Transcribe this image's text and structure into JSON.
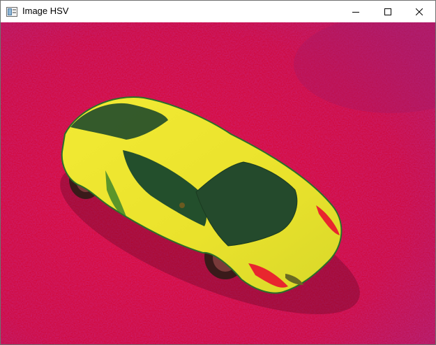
{
  "window": {
    "title": "Image HSV"
  },
  "icons": {
    "app": "image-window-icon",
    "minimize": "minimize-icon",
    "maximize": "maximize-icon",
    "close": "close-icon"
  },
  "colors": {
    "background": "#d4083a",
    "car_body": "#ece52e",
    "windows": "#2a5a2e",
    "tail_light": "#e8262e"
  }
}
